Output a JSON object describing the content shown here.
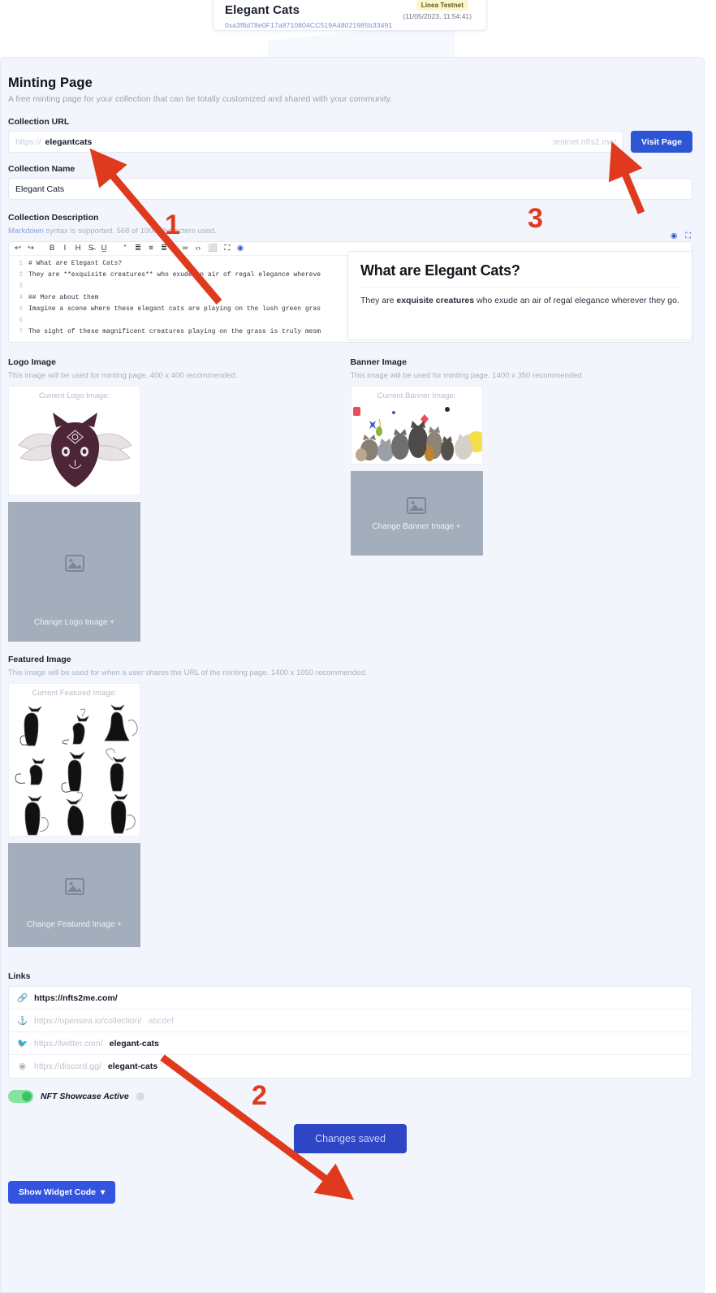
{
  "header": {
    "collection_title": "Elegant Cats",
    "contract_address": "0xa3f8d78e0F17a8710804CC519A48021985b33491",
    "network_badge": "Linea Testnet",
    "timestamp": "(11/05/2023, 11:54:41)"
  },
  "page": {
    "title": "Minting Page",
    "subtitle": "A free minting page for your collection that can be totally customized and shared with your community."
  },
  "collection_url": {
    "label": "Collection URL",
    "prefix": "https://",
    "value": "elegantcats",
    "suffix": ".testnet.nfts2.me/",
    "visit_button": "Visit Page"
  },
  "collection_name": {
    "label": "Collection Name",
    "value": "Elegant Cats"
  },
  "collection_description": {
    "label": "Collection Description",
    "help_link": "Markdown",
    "help_rest": " syntax is supported. 568 of 1000 characters used.",
    "toolbar": [
      {
        "name": "undo-icon",
        "glyph": "↩"
      },
      {
        "name": "redo-icon",
        "glyph": "↪"
      },
      {
        "name": "bold-icon",
        "glyph": "B"
      },
      {
        "name": "italic-icon",
        "glyph": "I"
      },
      {
        "name": "heading-icon",
        "glyph": "H"
      },
      {
        "name": "strikethrough-icon",
        "glyph": "S̶"
      },
      {
        "name": "underline-icon",
        "glyph": "U̲"
      },
      {
        "name": "quote-icon",
        "glyph": "”"
      },
      {
        "name": "ordered-list-icon",
        "glyph": "≣"
      },
      {
        "name": "bullet-list-icon",
        "glyph": "≡"
      },
      {
        "name": "checklist-icon",
        "glyph": "≣"
      },
      {
        "name": "link-icon",
        "glyph": "∞"
      },
      {
        "name": "code-icon",
        "glyph": "‹›"
      },
      {
        "name": "image-icon",
        "glyph": "⬜"
      },
      {
        "name": "fullscreen-icon",
        "glyph": "⛶"
      },
      {
        "name": "preview-eye-icon",
        "glyph": "◉"
      }
    ],
    "source_lines": [
      {
        "n": "1",
        "text": "# What are Elegant Cats?",
        "heading": true
      },
      {
        "n": "2",
        "text": "They are **exquisite creatures** who exude an air of regal elegance whereve",
        "heading": false
      },
      {
        "n": "3",
        "text": "",
        "heading": false
      },
      {
        "n": "4",
        "text": "##  More about them",
        "heading": true
      },
      {
        "n": "5",
        "text": "Imagine a scene where these elegant cats are playing on the lush green gras",
        "heading": false
      },
      {
        "n": "6",
        "text": "",
        "heading": false
      },
      {
        "n": "7",
        "text": "The sight of these magnificent creatures playing on the grass is truly mesm",
        "heading": false
      }
    ],
    "preview": {
      "heading": "What are Elegant Cats?",
      "body_pre": "They are ",
      "body_bold": "exquisite creatures",
      "body_post": " who exude an air of regal elegance wherever they go."
    }
  },
  "logo_image": {
    "label": "Logo Image",
    "help": "This image will be used for minting page. 400 x 400 recommended.",
    "current_caption": "Current Logo Image:",
    "change_label": "Change Logo Image",
    "change_plus": "+"
  },
  "banner_image": {
    "label": "Banner Image",
    "help": "This image will be used for minting page. 1400 x 350 recommended.",
    "current_caption": "Current Banner Image:",
    "change_label": "Change Banner Image",
    "change_plus": "+"
  },
  "featured_image": {
    "label": "Featured Image",
    "help": "This image will be used for when a user shares the URL of the minting page. 1400 x 1050 recommended.",
    "current_caption": "Current Featured Image:",
    "change_label": "Change Featured Image",
    "change_plus": "+"
  },
  "links": {
    "label": "Links",
    "rows": [
      {
        "icon": "link-icon",
        "prefix": "",
        "value": "https://nfts2me.com/",
        "muted": false
      },
      {
        "icon": "opensea-icon",
        "prefix": "https://opensea.io/collection/",
        "value": "abcdef",
        "muted": true
      },
      {
        "icon": "twitter-icon",
        "prefix": "https://twitter.com/",
        "value": "elegant-cats",
        "muted": false
      },
      {
        "icon": "discord-icon",
        "prefix": "https://discord.gg/",
        "value": "elegant-cats",
        "muted": false
      }
    ]
  },
  "showcase_toggle": {
    "label": "NFT Showcase Active",
    "state": "on"
  },
  "buttons": {
    "save": "Changes saved",
    "widget_code": "Show Widget Code",
    "widget_caret": "⌄"
  },
  "annotations": [
    {
      "number": "1"
    },
    {
      "number": "2"
    },
    {
      "number": "3"
    }
  ],
  "colors": {
    "accent_blue": "#2e55d4",
    "save_blue": "#2e45c5",
    "annotation_red": "#e03a1e",
    "toggle_green": "#3cc262",
    "panel_bg": "#f2f5fc",
    "badge_yellow": "#fdf6cd"
  }
}
